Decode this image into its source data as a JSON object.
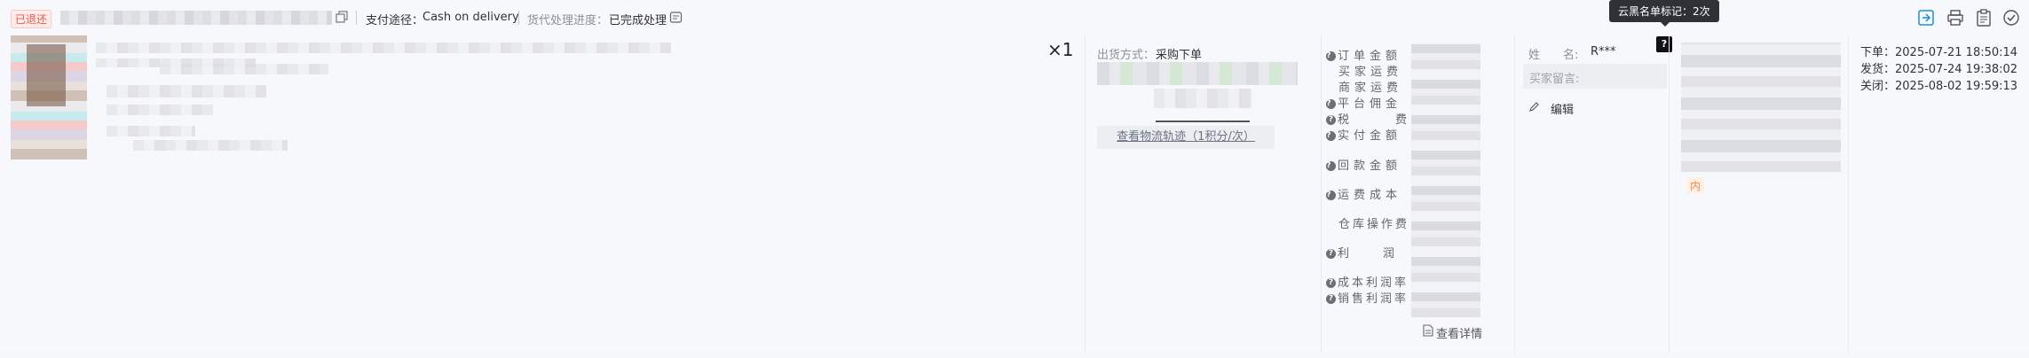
{
  "header": {
    "status_badge": "已退还",
    "payment_label": "支付途径：",
    "payment_value": "Cash on delivery",
    "progress_label": "货代处理进度：",
    "progress_value": "已完成处理"
  },
  "tooltip": {
    "text": "云黑名单标记：2次"
  },
  "blacklist_marker": "?",
  "product": {
    "quantity": "×1"
  },
  "shipping": {
    "method_label": "出货方式：",
    "method_value": "采购下单",
    "track_button": "查看物流轨迹（1积分/次）"
  },
  "fees": {
    "rows": [
      {
        "label": "订单金额",
        "help": true
      },
      {
        "label": "买家运费",
        "help": false
      },
      {
        "label": "商家运费",
        "help": false
      },
      {
        "label": "平台佣金",
        "help": true
      },
      {
        "label": "税费",
        "help": true
      },
      {
        "label": "实付金额",
        "help": true
      },
      {
        "label": "回款金额",
        "help": true
      },
      {
        "label": "运费成本",
        "help": true
      },
      {
        "label": "仓库操作费",
        "help": false
      },
      {
        "label": "利润",
        "help": true
      },
      {
        "label": "成本利润率",
        "help": true
      },
      {
        "label": "销售利润率",
        "help": true
      }
    ],
    "details_link": "查看详情"
  },
  "buyer": {
    "name_label": "姓　　名:",
    "name_value": "R***",
    "message_placeholder": "买家留言:",
    "edit_label": "编辑"
  },
  "tag": {
    "inner": "内"
  },
  "times": {
    "order": "下单：2025-07-21 18:50:14",
    "ship": "发货：2025-07-24 19:38:02",
    "close": "关闭：2025-08-02 19:59:13"
  },
  "icons": [
    "copy-icon",
    "receipt-icon",
    "export-icon",
    "print-icon",
    "clipboard-icon",
    "check-circle-icon",
    "edit-icon",
    "document-icon"
  ]
}
